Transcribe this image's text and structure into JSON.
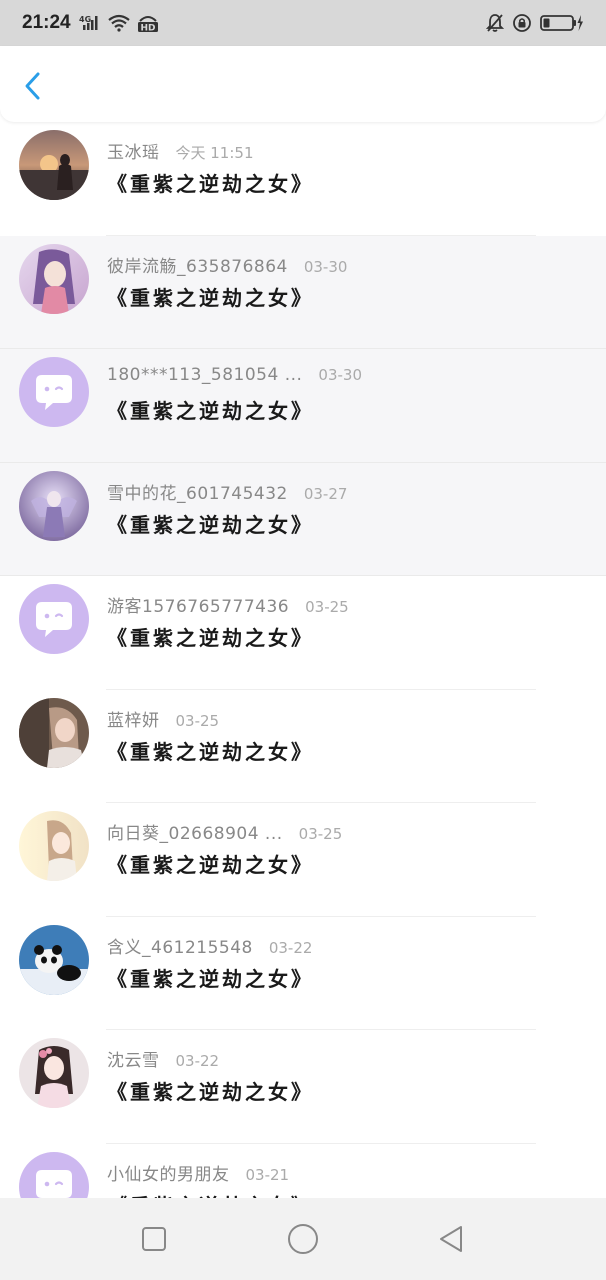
{
  "status_bar": {
    "time": "21:24",
    "network": "4G",
    "hd_label": "HD"
  },
  "header": {
    "back_icon": "chevron-left-icon",
    "accent_color": "#2a9ee8"
  },
  "messages": [
    {
      "name": "玉冰瑶",
      "time": "今天 11:51",
      "message": "《重紫之逆劫之女》",
      "avatar": "photo-sunset"
    },
    {
      "name": "彼岸流觞_635876864",
      "time": "03-30",
      "message": "《重紫之逆劫之女》",
      "avatar": "photo-anime-girl"
    },
    {
      "name": "180***113_581054 ...",
      "time": "03-30",
      "message": "《重紫之逆劫之女》",
      "avatar": "default-chat-avatar"
    },
    {
      "name": "雪中的花_601745432",
      "time": "03-27",
      "message": "《重紫之逆劫之女》",
      "avatar": "photo-anime-fairy"
    },
    {
      "name": "游客1576765777436",
      "time": "03-25",
      "message": "《重紫之逆劫之女》",
      "avatar": "default-chat-avatar"
    },
    {
      "name": "蓝梓妍",
      "time": "03-25",
      "message": "《重紫之逆劫之女》",
      "avatar": "photo-girl-portrait"
    },
    {
      "name": "向日葵_02668904 ...",
      "time": "03-25",
      "message": "《重紫之逆劫之女》",
      "avatar": "photo-girl-bright"
    },
    {
      "name": "含义_461215548",
      "time": "03-22",
      "message": "《重紫之逆劫之女》",
      "avatar": "photo-panda"
    },
    {
      "name": "沈云雪",
      "time": "03-22",
      "message": "《重紫之逆劫之女》",
      "avatar": "photo-girl-flowers"
    },
    {
      "name": "小仙女的男朋友",
      "time": "03-21",
      "message": "《重紫之逆劫之女》",
      "avatar": "default-chat-avatar"
    }
  ],
  "colors": {
    "default_avatar_bg": "#cdb8f0",
    "name_gray": "#888888",
    "message_black": "#1a1a1a"
  },
  "nav_bar": {
    "icons": [
      "square-icon",
      "circle-icon",
      "triangle-back-icon"
    ]
  }
}
